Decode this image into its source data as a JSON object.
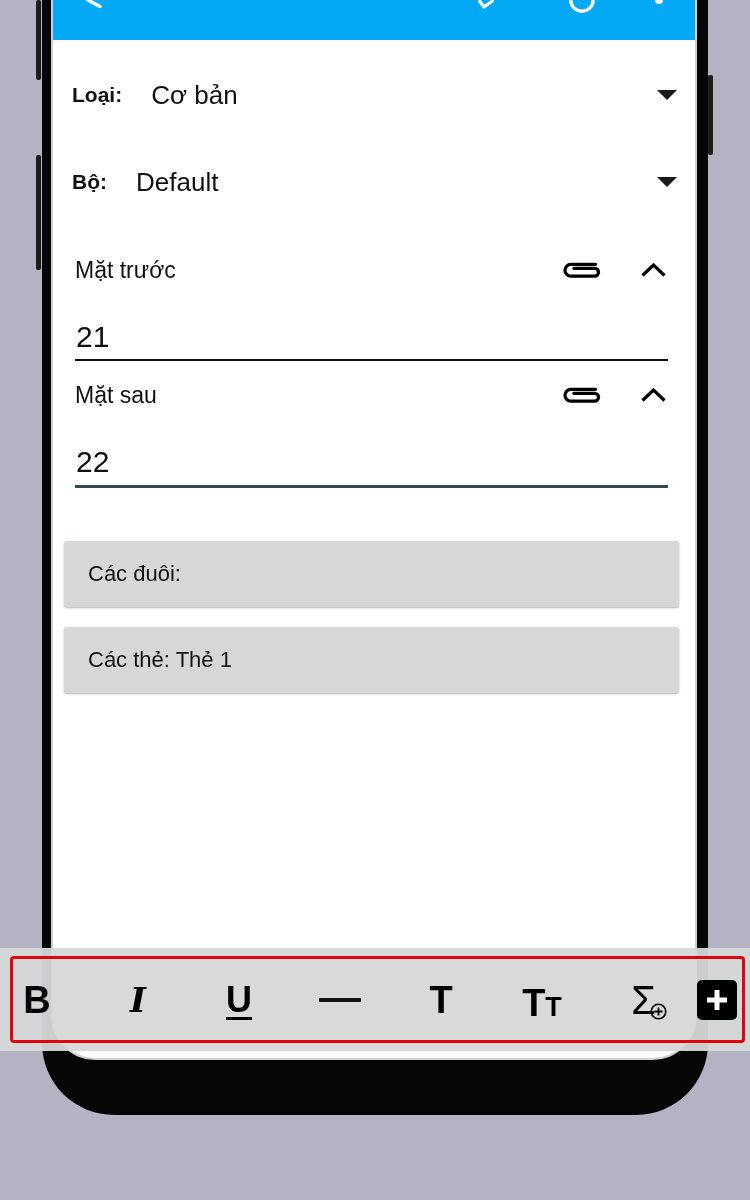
{
  "selects": [
    {
      "label": "Loại:",
      "value": "Cơ bản"
    },
    {
      "label": "Bộ:",
      "value": "Default"
    }
  ],
  "editors": [
    {
      "label": "Mặt trước",
      "value": "21",
      "expanded": true,
      "focused": false
    },
    {
      "label": "Mặt sau",
      "value": "22",
      "expanded": true,
      "focused": true
    }
  ],
  "panels": [
    {
      "text": "Các đuôi:"
    },
    {
      "text": "Các thẻ: Thẻ 1"
    }
  ],
  "toolbar": {
    "buttons": [
      {
        "kind": "bold",
        "label": "B"
      },
      {
        "kind": "italic",
        "label": "I"
      },
      {
        "kind": "underline",
        "label": "U"
      },
      {
        "kind": "rule"
      },
      {
        "kind": "title",
        "label": "T"
      },
      {
        "kind": "text_size",
        "label": "TT"
      },
      {
        "kind": "formula",
        "label": "Σ"
      },
      {
        "kind": "add"
      }
    ]
  }
}
